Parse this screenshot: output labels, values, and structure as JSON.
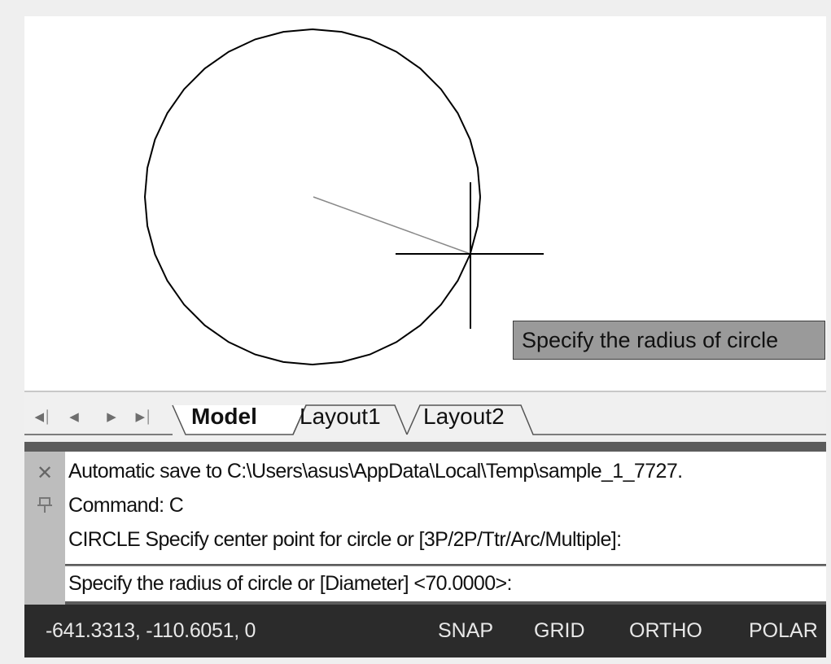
{
  "drawing": {
    "tooltip": "Specify the radius of circle",
    "accent_line_color": "#888888",
    "entity_color": "#000000"
  },
  "tabs": {
    "nav_first_icon": "first-page-icon",
    "nav_prev_icon": "previous-icon",
    "nav_next_icon": "next-icon",
    "nav_last_icon": "last-page-icon",
    "items": [
      {
        "label": "Model",
        "active": true
      },
      {
        "label": "Layout1",
        "active": false
      },
      {
        "label": "Layout2",
        "active": false
      }
    ]
  },
  "command_window": {
    "close_icon": "close-icon",
    "pin_icon": "pin-icon",
    "history": [
      "Automatic save to C:\\Users\\asus\\AppData\\Local\\Temp\\sample_1_7727.",
      "Command: C",
      "CIRCLE Specify center point for circle or [3P/2P/Ttr/Arc/Multiple]:"
    ],
    "prompt": "Specify the radius of circle or [Diameter] <70.0000>:"
  },
  "status_bar": {
    "coordinates": "-641.3313, -110.6051, 0",
    "toggles": [
      "SNAP",
      "GRID",
      "ORTHO",
      "POLAR"
    ],
    "background": "#2b2b2b"
  }
}
